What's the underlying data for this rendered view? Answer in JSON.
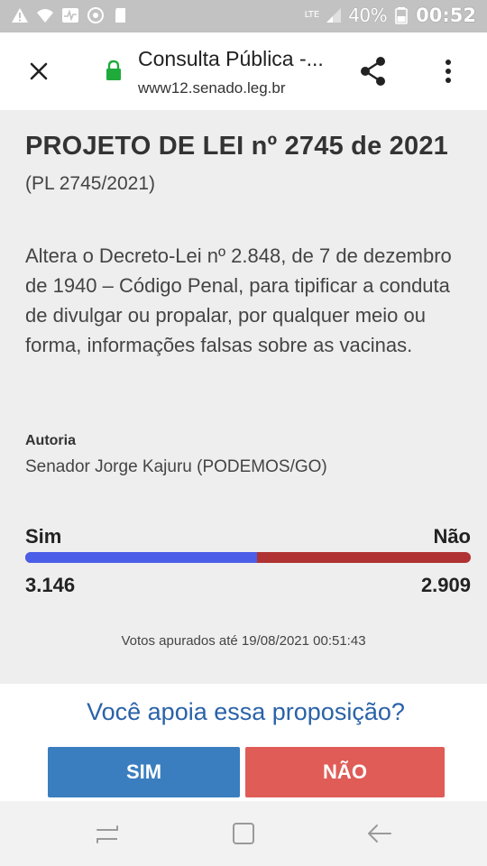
{
  "status_bar": {
    "network": "LTE",
    "battery": "40%",
    "time": "00:52",
    "icons": [
      "warning-icon",
      "wifi-icon",
      "activity-icon",
      "sync-icon",
      "sdcard-icon",
      "signal-icon",
      "battery-icon"
    ]
  },
  "toolbar": {
    "title": "Consulta Pública -...",
    "url": "www12.senado.leg.br",
    "lock_color": "#1faa3c"
  },
  "project": {
    "title": "PROJETO DE LEI nº 2745 de 2021",
    "code": "(PL 2745/2021)",
    "description": "Altera o Decreto-Lei nº 2.848, de 7 de dezembro de 1940 – Código Penal, para tipificar a conduta de divulgar ou propalar, por qualquer meio ou forma, informações falsas sobre as vacinas.",
    "autoria_label": "Autoria",
    "autoria_value": "Senador Jorge Kajuru (PODEMOS/GO)"
  },
  "votes": {
    "sim_label": "Sim",
    "nao_label": "Não",
    "sim_count": "3.146",
    "nao_count": "2.909",
    "sim_share": 0.5196,
    "sim_color": "#4b5ee8",
    "nao_color": "#b03232",
    "apurados": "Votos apurados até 19/08/2021 00:51:43"
  },
  "support": {
    "question": "Você apoia essa proposição?",
    "sim_button": "SIM",
    "nao_button": "NÃO",
    "sim_color": "#3a7ec0",
    "nao_color": "#df5c57"
  }
}
